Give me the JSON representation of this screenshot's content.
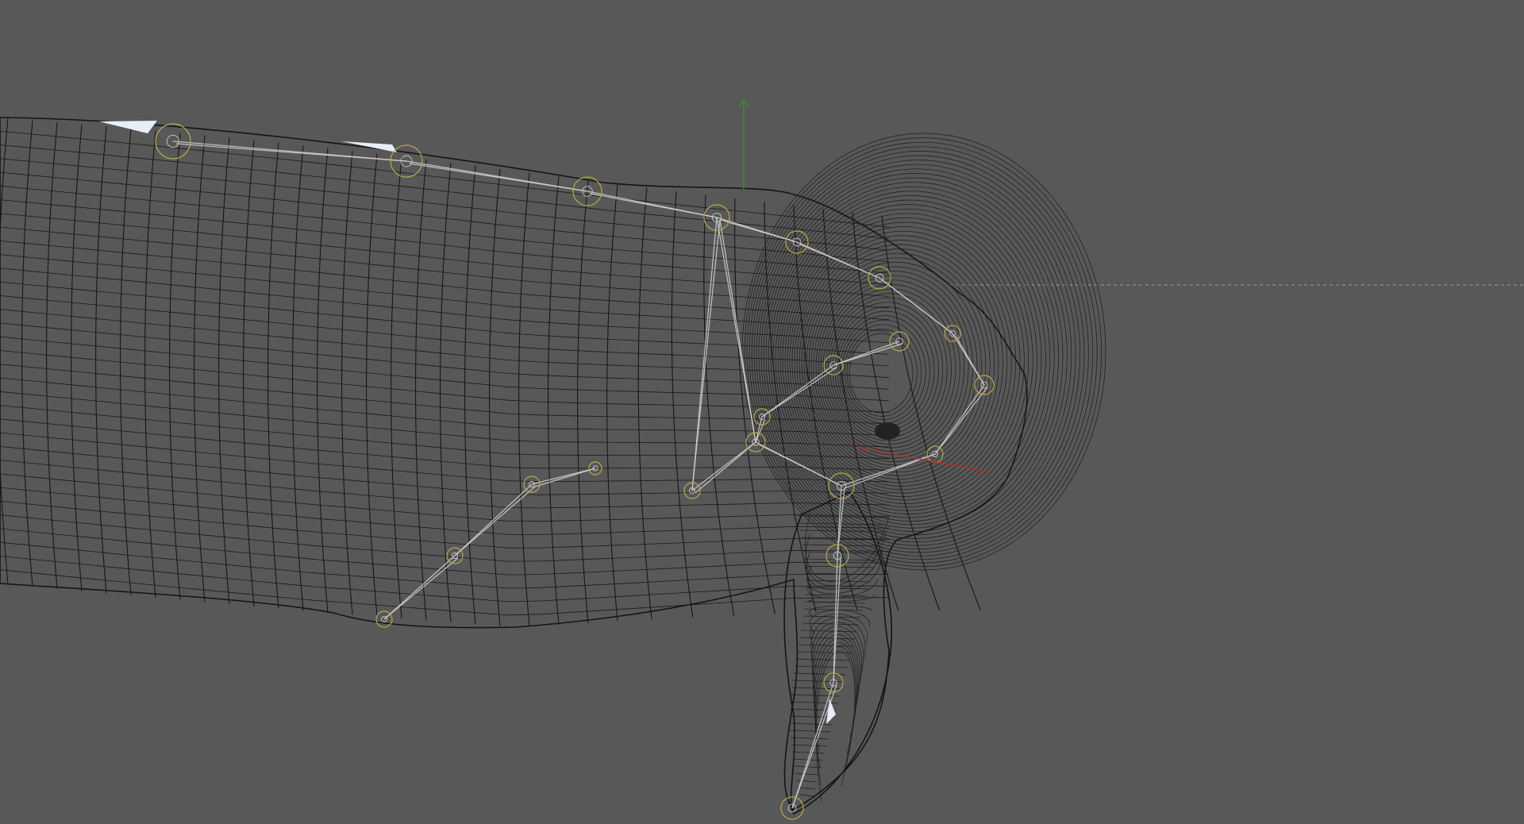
{
  "viewport": {
    "background_color": "#585858",
    "wireframe_color": "#161616",
    "bone_color": "#cfcfcf",
    "joint_color": "#b7a94a",
    "axis_y_color": "#2e9a2e",
    "axis_x_color": "#c02a2a",
    "horizon_color": "#9a9a9a"
  },
  "scene": {
    "object": "whale-mesh-wireframe",
    "gizmo": "move-gizmo",
    "rig": "bone-rig"
  }
}
